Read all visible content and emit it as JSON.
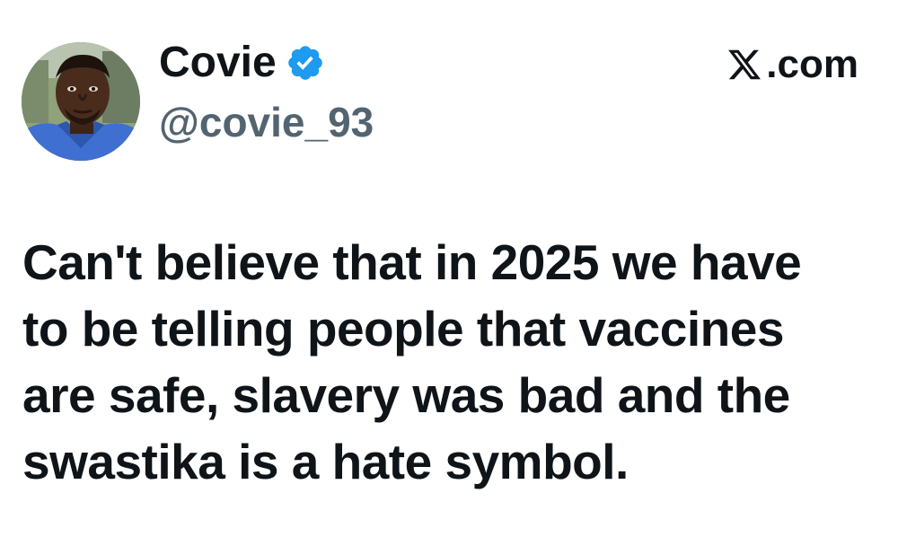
{
  "author": {
    "display_name": "Covie",
    "handle": "@covie_93",
    "verified": true,
    "verified_color": "#1d9bf0"
  },
  "brand": {
    "domain": ".com",
    "logo_icon": "x-logo-icon"
  },
  "tweet": {
    "lines": [
      "Can't believe that in 2025 we have",
      "to be telling people that vaccines",
      "are safe, slavery was bad and the",
      "swastika is a hate symbol."
    ]
  },
  "colors": {
    "text_primary": "#0f1419",
    "text_secondary": "#536471",
    "background": "#ffffff"
  }
}
